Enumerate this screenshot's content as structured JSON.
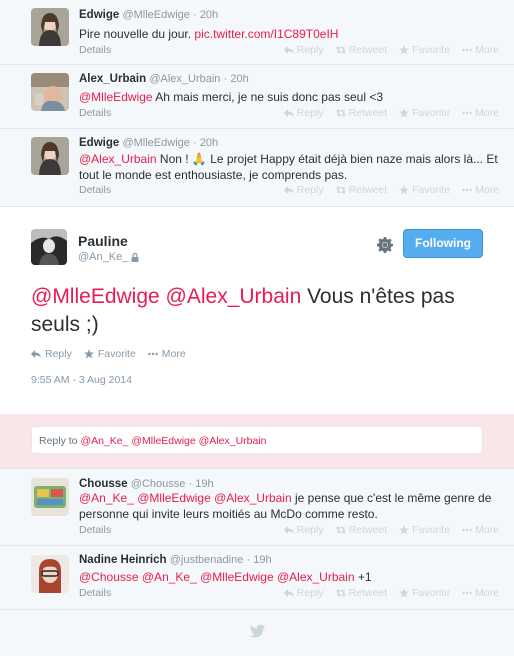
{
  "actions": {
    "reply": "Reply",
    "retweet": "Retweet",
    "favorite": "Favorite",
    "more": "More",
    "details": "Details"
  },
  "tweets": [
    {
      "name": "Edwige",
      "handle": "@MlleEdwige",
      "time": "· 20h",
      "text": "Pire nouvelle du jour. ",
      "link": "pic.twitter.com/I1C89T0eIH"
    },
    {
      "name": "Alex_Urbain",
      "handle": "@Alex_Urbain",
      "time": "· 20h",
      "mention": "@MlleEdwige",
      "text": " Ah mais merci, je ne suis donc pas seul <3"
    },
    {
      "name": "Edwige",
      "handle": "@MlleEdwige",
      "time": "· 20h",
      "mention": "@Alex_Urbain",
      "text": " Non ! 🙏 Le projet Happy était déjà bien naze mais alors là... Et tout le monde est enthousiaste, je comprends pas."
    }
  ],
  "main": {
    "name": "Pauline",
    "handle": "@An_Ke_",
    "follow_label": "Following",
    "mentions": "@MlleEdwige @Alex_Urbain",
    "text": " Vous n'êtes pas seuls ;)",
    "timestamp": "9:55 AM - 3 Aug 2014"
  },
  "reply_box": {
    "prefix": "Reply to ",
    "mentions": "@An_Ke_ @MlleEdwige @Alex_Urbain"
  },
  "replies": [
    {
      "name": "Chousse",
      "handle": "@Chousse",
      "time": "· 19h",
      "mentions": "@An_Ke_ @MlleEdwige @Alex_Urbain",
      "text": " je pense que c'est le même genre de personne qui invite leurs moitiés au McDo comme resto."
    },
    {
      "name": "Nadine Heinrich",
      "handle": "@justbenadine",
      "time": "· 19h",
      "mentions": "@Chousse @An_Ke_ @MlleEdwige @Alex_Urbain",
      "text": " +1"
    }
  ],
  "colors": {
    "link": "#e81c4f",
    "follow_button": "#55acee",
    "reply_band": "#f9e6e9"
  }
}
